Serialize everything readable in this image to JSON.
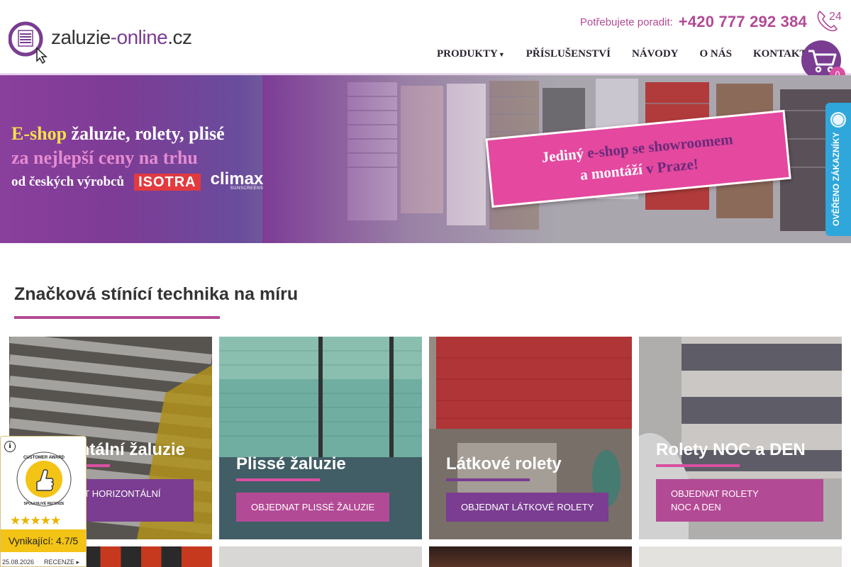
{
  "header": {
    "logo_text_main": "zaluzie",
    "logo_text_accent": "-online",
    "logo_text_tld": ".cz",
    "contact_label": "Potřebujete poradit:",
    "contact_phone": "+420 777 292 384",
    "phone_badge": "24",
    "nav": [
      {
        "label": "PRODUKTY",
        "has_dropdown": true
      },
      {
        "label": "PŘÍSLUŠENSTVÍ"
      },
      {
        "label": "NÁVODY"
      },
      {
        "label": "O NÁS"
      },
      {
        "label": "KONTAKT"
      }
    ],
    "cart_count": "0",
    "cart_icon": "shopping-cart-icon"
  },
  "hero": {
    "line1_accent": "E-shop",
    "line1_rest": " žaluzie, rolety, plisé",
    "line2": "za nejlepší ceny na trhu",
    "line3": "od českých výrobců",
    "brand1": "ISOTRA",
    "brand2": "climax",
    "brand2_sub": "SUNSCREENS",
    "showroom_a": "Jediný ",
    "showroom_b": "e-shop se showroomem",
    "showroom_c": "a montáží ",
    "showroom_d": "v Praze!"
  },
  "verified_badge": {
    "label": "OVĚŘENO ZÁKAZNÍKY"
  },
  "section": {
    "title": "Značková stínící technika na míru"
  },
  "cards": [
    {
      "title": "Horizontální žaluzie",
      "button": "OBJEDNAT HORIZONTÁLNÍ ŽALUZIE"
    },
    {
      "title": "Plissé žaluzie",
      "button": "OBJEDNAT PLISSÉ ŽALUZIE"
    },
    {
      "title": "Látkové rolety",
      "button": "OBJEDNAT LÁTKOVÉ ROLETY"
    },
    {
      "title": "Rolety NOC a DEN",
      "button_l1": "OBJEDNAT ROLETY",
      "button_l2": "NOC A DEN"
    }
  ],
  "review_widget": {
    "award_text": "CUSTOMER AWARD",
    "award_sub": "SPOLEHLIVÉ RECENZE",
    "rating": 4.7,
    "score_label": "Vynikající: 4.7/5",
    "date": "25.08.2026",
    "link": "RECENZE"
  },
  "colors": {
    "brand_purple": "#7a3d91",
    "brand_pink": "#d94fa3",
    "header_text": "#b34a95",
    "verified_blue": "#2fa7db",
    "review_yellow": "#f3c316"
  }
}
